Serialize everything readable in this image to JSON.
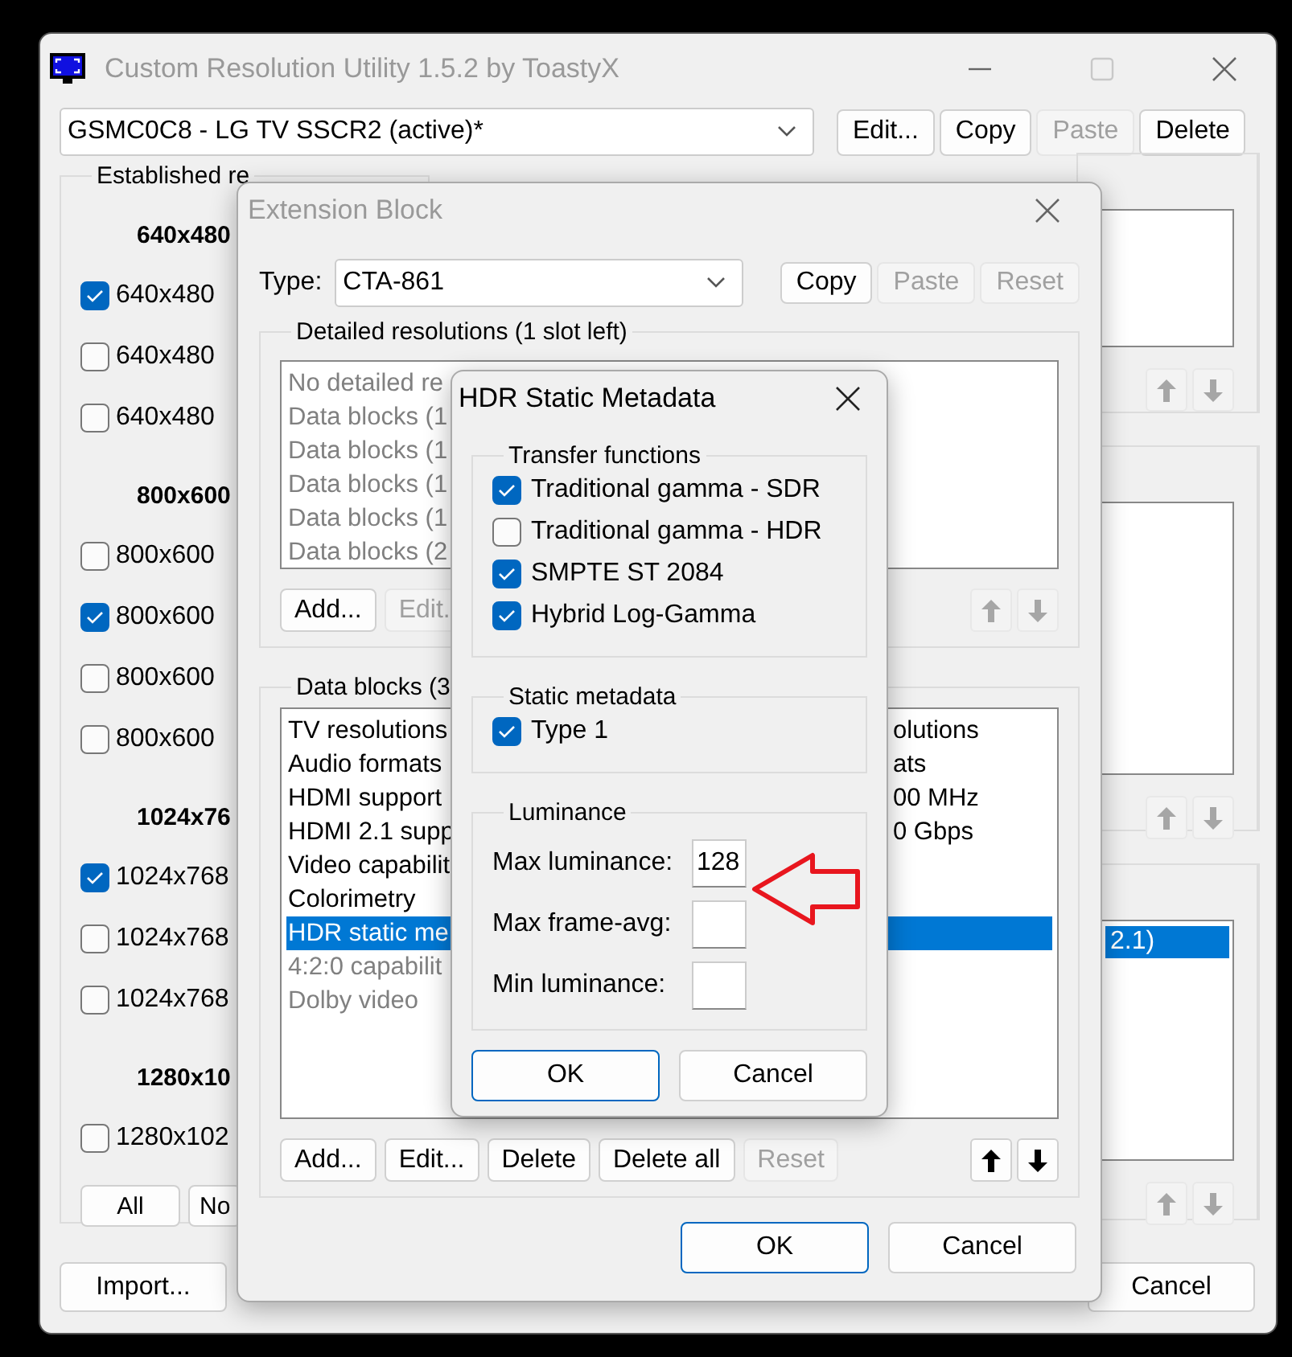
{
  "main_window": {
    "title": "Custom Resolution Utility 1.5.2 by ToastyX",
    "active": false,
    "monitor": "GSMC0C8 - LG TV SSCR2 (active)*",
    "buttons": [
      {
        "label": "Edit...",
        "disabled": false
      },
      {
        "label": "Copy",
        "disabled": false
      },
      {
        "label": "Paste",
        "disabled": true
      },
      {
        "label": "Delete",
        "disabled": false
      }
    ],
    "established": {
      "title": "Established re",
      "groups": [
        {
          "heading": "640x480",
          "items": [
            {
              "label": "640x480",
              "checked": true
            },
            {
              "label": "640x480",
              "checked": false
            },
            {
              "label": "640x480",
              "checked": false
            }
          ]
        },
        {
          "heading": "800x600",
          "items": [
            {
              "label": "800x600",
              "checked": false
            },
            {
              "label": "800x600",
              "checked": true
            },
            {
              "label": "800x600",
              "checked": false
            },
            {
              "label": "800x600",
              "checked": false
            }
          ]
        },
        {
          "heading": "1024x76",
          "items": [
            {
              "label": "1024x768",
              "checked": true
            },
            {
              "label": "1024x768",
              "checked": false
            },
            {
              "label": "1024x768",
              "checked": false
            }
          ]
        },
        {
          "heading": "1280x10",
          "items": [
            {
              "label": "1280x102",
              "checked": false
            }
          ]
        }
      ],
      "buttons": [
        "All",
        "No"
      ]
    },
    "side_lists": [
      {
        "arrows_disabled": true
      },
      {
        "arrows_disabled": true
      },
      {
        "arrows_disabled": true,
        "rows": [
          {
            "text": "2.1)",
            "selected": true
          }
        ]
      }
    ],
    "import_button": "Import...",
    "cancel_button": "Cancel"
  },
  "extension_block": {
    "title": "Extension Block",
    "active": false,
    "type_label": "Type:",
    "type_value": "CTA-861",
    "buttons": [
      {
        "label": "Copy",
        "disabled": false
      },
      {
        "label": "Paste",
        "disabled": true
      },
      {
        "label": "Reset",
        "disabled": true
      }
    ],
    "detailed": {
      "title": "Detailed resolutions (1 slot left)",
      "rows": [
        {
          "text": "No detailed re",
          "disabled": true
        },
        {
          "text": "Data blocks (1",
          "disabled": true
        },
        {
          "text": "Data blocks (1",
          "disabled": true
        },
        {
          "text": "Data blocks (1",
          "disabled": true
        },
        {
          "text": "Data blocks (1",
          "disabled": true
        },
        {
          "text": "Data blocks (2",
          "disabled": true
        }
      ],
      "buttons": [
        {
          "label": "Add...",
          "disabled": false
        },
        {
          "label": "Edit.",
          "disabled": true
        }
      ],
      "arrows_disabled": true
    },
    "data_blocks": {
      "title": "Data blocks (3",
      "rows": [
        {
          "text": "TV resolutions",
          "tail": "olutions",
          "selected": false,
          "disabled": false
        },
        {
          "text": "Audio formats",
          "tail": "ats",
          "selected": false,
          "disabled": false
        },
        {
          "text": "HDMI support",
          "tail": "00 MHz",
          "selected": false,
          "disabled": false
        },
        {
          "text": "HDMI 2.1 supp",
          "tail": "0 Gbps",
          "selected": false,
          "disabled": false
        },
        {
          "text": "Video capabilit",
          "selected": false,
          "disabled": false
        },
        {
          "text": "Colorimetry",
          "selected": false,
          "disabled": false
        },
        {
          "text": "HDR static me",
          "selected": true,
          "disabled": false
        },
        {
          "text": "4:2:0 capabilit",
          "selected": false,
          "disabled": true
        },
        {
          "text": "Dolby video",
          "selected": false,
          "disabled": true
        }
      ],
      "buttons": [
        {
          "label": "Add...",
          "disabled": false
        },
        {
          "label": "Edit...",
          "disabled": false
        },
        {
          "label": "Delete",
          "disabled": false
        },
        {
          "label": "Delete all",
          "disabled": false
        },
        {
          "label": "Reset",
          "disabled": true
        }
      ],
      "arrows_disabled": false
    },
    "ok_button": "OK",
    "cancel_button": "Cancel"
  },
  "hdr_dialog": {
    "title": "HDR Static Metadata",
    "active": true,
    "transfer": {
      "title": "Transfer functions",
      "items": [
        {
          "label": "Traditional gamma - SDR",
          "checked": true
        },
        {
          "label": "Traditional gamma - HDR",
          "checked": false
        },
        {
          "label": "SMPTE ST 2084",
          "checked": true
        },
        {
          "label": "Hybrid Log-Gamma",
          "checked": true
        }
      ]
    },
    "static": {
      "title": "Static metadata",
      "items": [
        {
          "label": "Type 1",
          "checked": true
        }
      ]
    },
    "luminance": {
      "title": "Luminance",
      "fields": [
        {
          "label": "Max luminance:",
          "value": "128"
        },
        {
          "label": "Max frame-avg:"
        },
        {
          "label": "Min luminance:"
        }
      ]
    },
    "ok_button": "OK",
    "cancel_button": "Cancel"
  }
}
